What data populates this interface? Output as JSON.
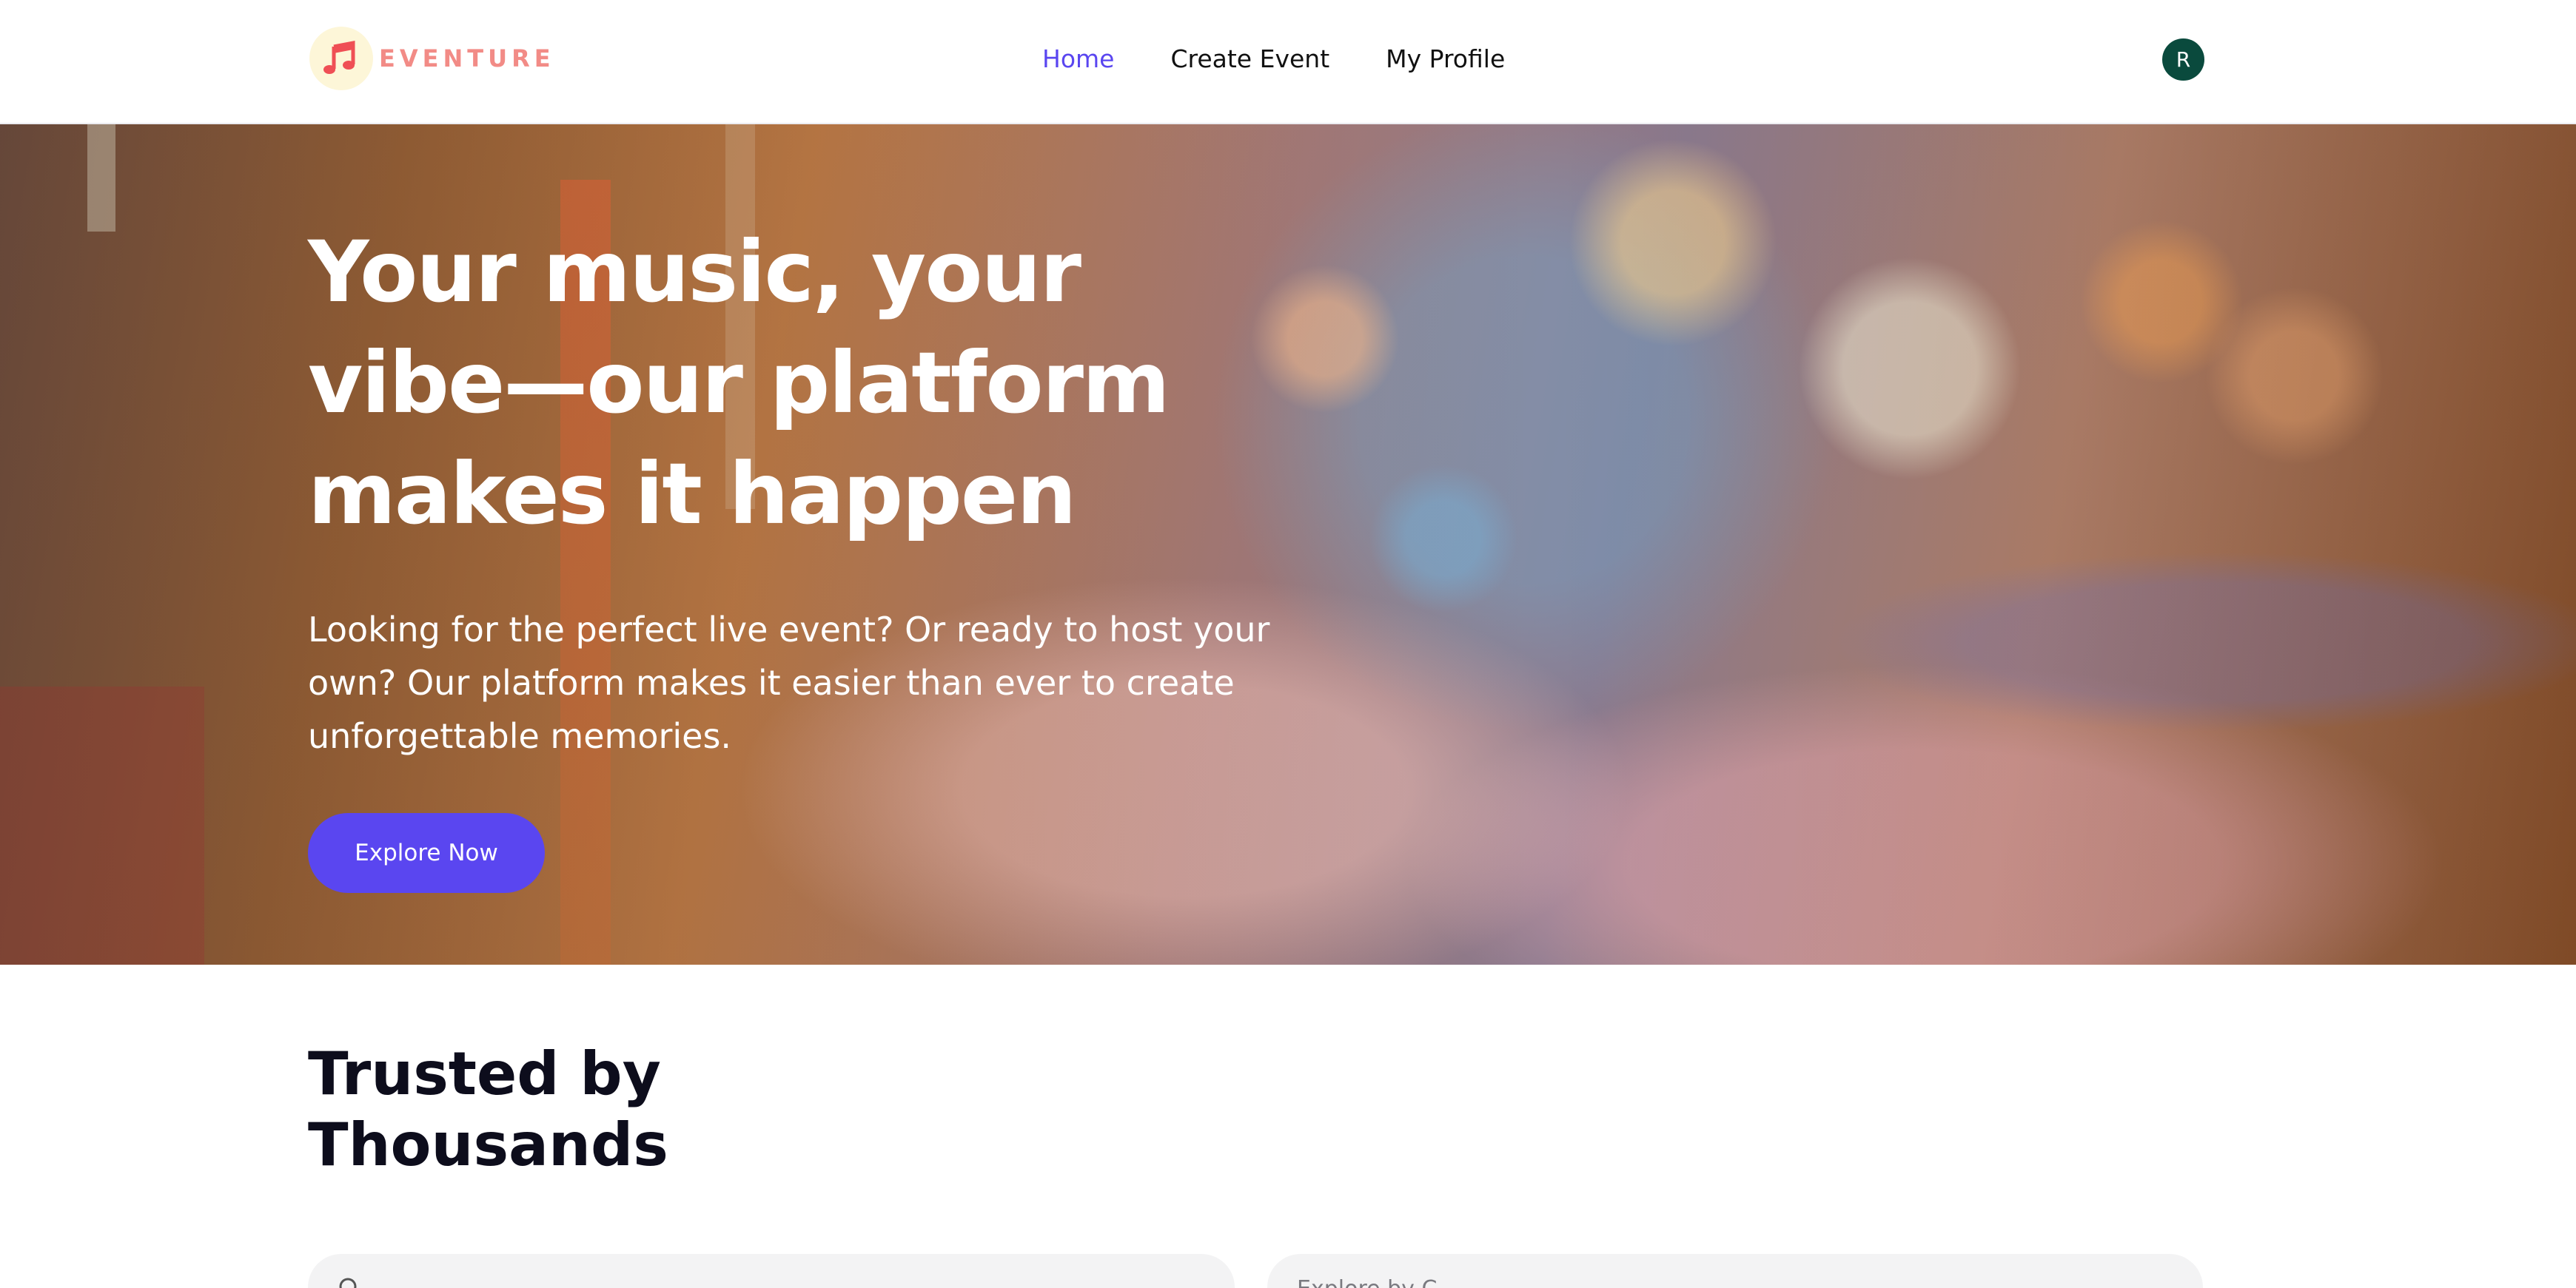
{
  "app": {
    "brand": "EVENTURE",
    "colors": {
      "accent": "#5a46f0",
      "logo_text": "#f28b86",
      "avatar_bg": "#0a4a3d"
    }
  },
  "header": {
    "logo_icon": "music-note-icon",
    "nav": [
      {
        "label": "Home",
        "active": true
      },
      {
        "label": "Create Event",
        "active": false
      },
      {
        "label": "My Profile",
        "active": false
      }
    ],
    "avatar_initial": "R"
  },
  "hero": {
    "title": "Your music, your vibe—our platform makes it happen",
    "subtitle": "Looking for the perfect live event? Or ready to host your own? Our platform makes it easier than ever to create unforgettable memories.",
    "cta_label": "Explore Now"
  },
  "trusted": {
    "title_line1": "Trusted by",
    "title_line2": "Thousands",
    "search_icon": "search-icon",
    "search_placeholder": "",
    "filter_label": "Explore by C..."
  }
}
